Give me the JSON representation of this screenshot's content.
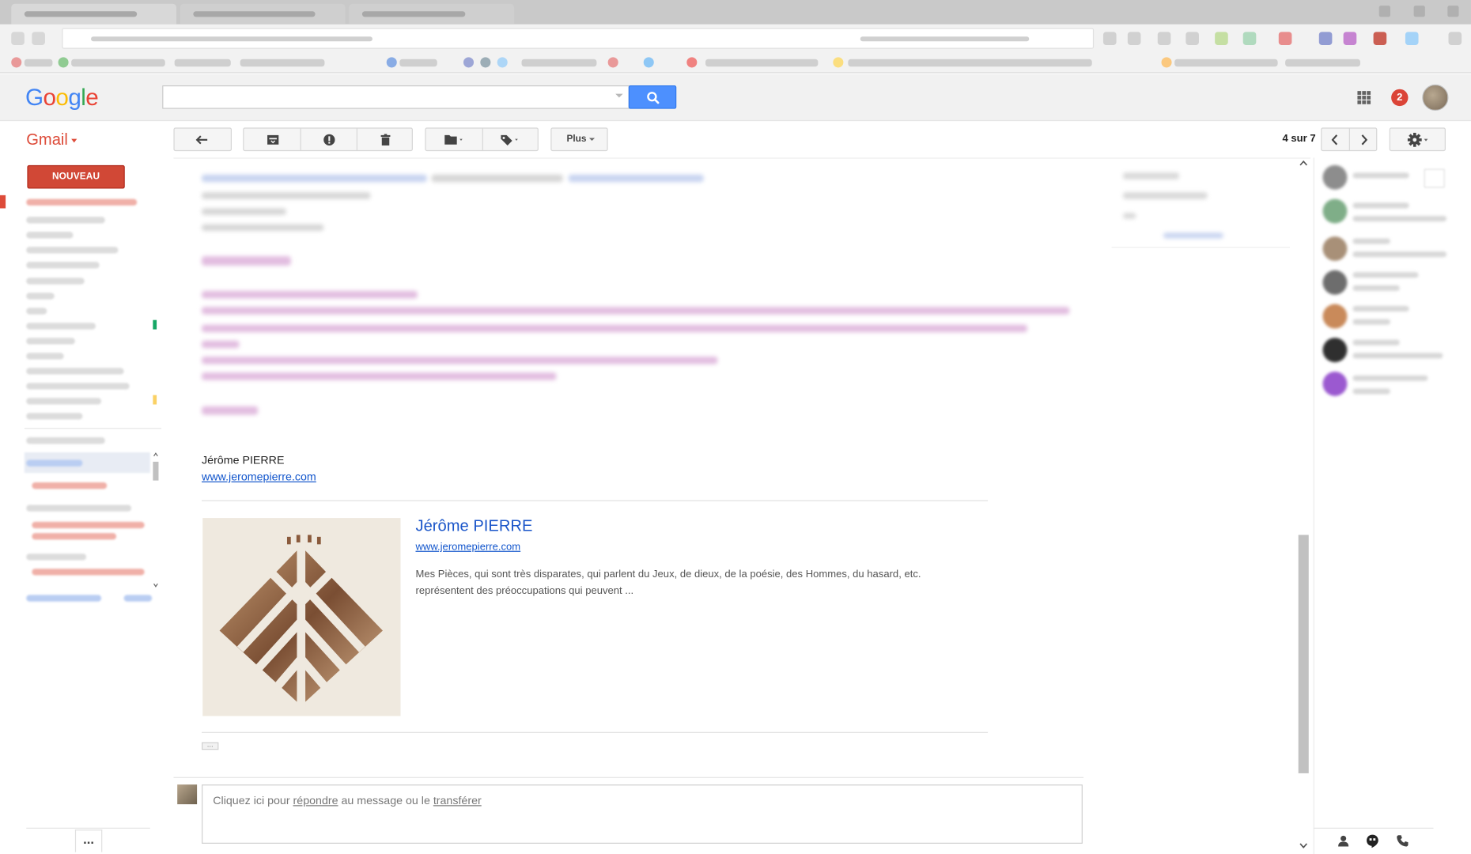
{
  "header": {
    "logo_letters": [
      {
        "ch": "G",
        "color": "#4285f4"
      },
      {
        "ch": "o",
        "color": "#ea4335"
      },
      {
        "ch": "o",
        "color": "#fbbc05"
      },
      {
        "ch": "g",
        "color": "#4285f4"
      },
      {
        "ch": "l",
        "color": "#34a853"
      },
      {
        "ch": "e",
        "color": "#ea4335"
      }
    ],
    "search_value": "",
    "notification_count": "2"
  },
  "nav": {
    "gmail_label": "Gmail",
    "compose_label": "NOUVEAU MESSAGE",
    "more_label": "..."
  },
  "toolbar": {
    "more_label": "Plus",
    "pager_text": "4 sur 7"
  },
  "message": {
    "signature_name": "Jérôme PIERRE",
    "signature_link": "www.jeromepierre.com",
    "card": {
      "title": "Jérôme PIERRE",
      "url": "www.jeromepierre.com",
      "description": "Mes Pièces, qui sont très disparates, qui parlent du Jeux, de dieux, de la poésie, des Hommes, du hasard, etc. représentent des préoccupations qui peuvent ..."
    },
    "ellipsis_label": "..."
  },
  "reply": {
    "prefix": "Cliquez ici pour ",
    "reply_link": "répondre",
    "middle": " au message ou le ",
    "forward_link": "transférer"
  },
  "colors": {
    "brand_red": "#dd4b39",
    "search_blue": "#4d90fe",
    "link_blue": "#1155cc"
  }
}
